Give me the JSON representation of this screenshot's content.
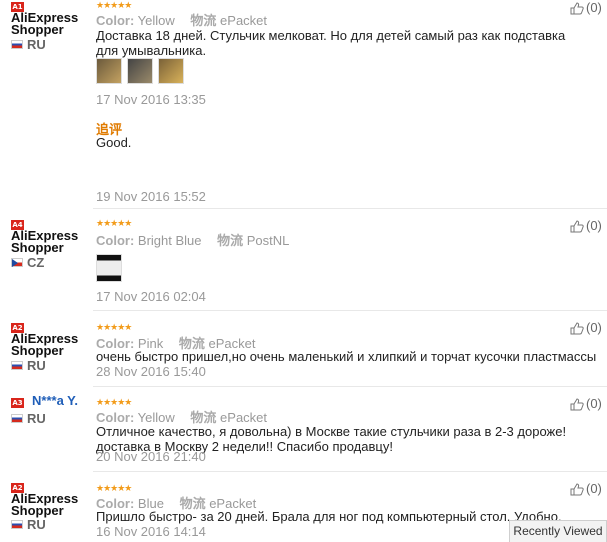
{
  "reviews": [
    {
      "badge": "A1",
      "name": "AliExpress Shopper",
      "country": "RU",
      "rating_stars": "★★★★★",
      "rating": 5,
      "color_label": "Color:",
      "color_value": "Yellow",
      "shipping_label": "物流",
      "shipping_value": "ePacket",
      "text": "Доставка 18 дней. Стульчик мелковат. Но для детей самый раз как подставка для умывальника.",
      "date": "17 Nov 2016 13:35",
      "followup_label": "追评",
      "followup_text": "Good.",
      "followup_date": "19 Nov 2016 15:52",
      "likes": "(0)"
    },
    {
      "badge": "A4",
      "name": "AliExpress Shopper",
      "country": "CZ",
      "rating_stars": "★★★★★",
      "rating": 5,
      "color_label": "Color:",
      "color_value": "Bright Blue",
      "shipping_label": "物流",
      "shipping_value": "PostNL",
      "date": "17 Nov 2016 02:04",
      "likes": "(0)"
    },
    {
      "badge": "A2",
      "name": "AliExpress Shopper",
      "country": "RU",
      "rating_stars": "★★★★★",
      "rating": 5,
      "color_label": "Color:",
      "color_value": "Pink",
      "shipping_label": "物流",
      "shipping_value": "ePacket",
      "text": "очень быстро пришел,но очень маленький и хлипкий и торчат кусочки пластмассы",
      "date": "28 Nov 2016 15:40",
      "likes": "(0)"
    },
    {
      "badge": "A3",
      "name": "N***a Y.",
      "country": "RU",
      "rating_stars": "★★★★★",
      "rating": 5,
      "color_label": "Color:",
      "color_value": "Yellow",
      "shipping_label": "物流",
      "shipping_value": "ePacket",
      "text": "Отличное качество, я довольна) в Москве такие стульчики раза в 2-3 дороже! доставка в Москву 2 недели!! Спасибо продавцу!",
      "date": "20 Nov 2016 21:40",
      "likes": "(0)"
    },
    {
      "badge": "A2",
      "name": "AliExpress Shopper",
      "country": "RU",
      "rating_stars": "★★★★★",
      "rating": 5,
      "color_label": "Color:",
      "color_value": "Blue",
      "shipping_label": "物流",
      "shipping_value": "ePacket",
      "text": "Пришло быстро- за 20 дней. Брала для ног под компьютерный стол. Удобно.",
      "date": "16 Nov 2016 14:14",
      "likes": "(0)"
    }
  ],
  "recently_viewed": "Recently Viewed",
  "colors": {
    "star": "#f29b1a",
    "badge_red": "#d9251b",
    "badge_blue": "#1f5eb8",
    "followup": "#e07b00"
  }
}
